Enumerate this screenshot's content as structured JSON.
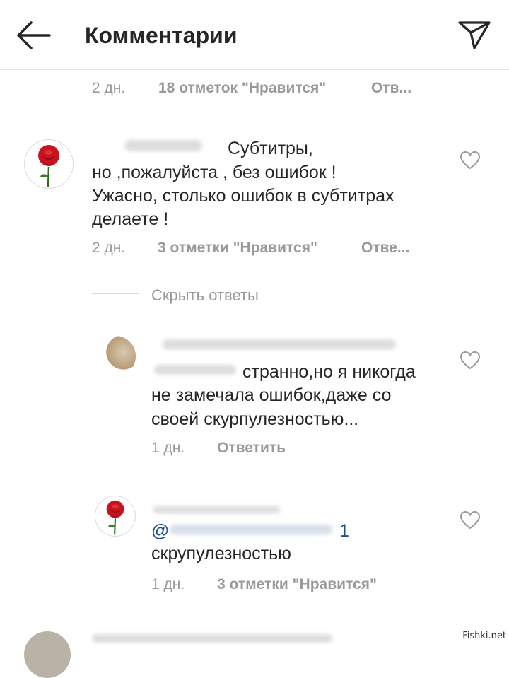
{
  "header": {
    "title": "Комментарии"
  },
  "top_comment_meta": {
    "time": "2 дн.",
    "likes": "18 отметок \"Нравится\"",
    "reply": "Отв..."
  },
  "comment_main": {
    "text_line1": "Субтитры,",
    "text_line2": "но ,пожалуйста , без ошибок !",
    "text_line3": "Ужасно, столько ошибок в субтитрах",
    "text_line4": "делаете !",
    "time": "2 дн.",
    "likes": "3 отметки \"Нравится\"",
    "reply": "Отве..."
  },
  "hide_replies": "Скрыть ответы",
  "reply1": {
    "text_line1": "странно,но я никогда",
    "text_line2": "не замечала ошибок,даже со",
    "text_line3": "своей скурпулезностью...",
    "time": "1 дн.",
    "reply": "Ответить"
  },
  "reply2": {
    "mention_start": "@",
    "mention_end": "1",
    "text_line1": "скрупулезностью",
    "time": "1 дн.",
    "likes": "3 отметки \"Нравится\""
  },
  "watermark": "Fishki.net",
  "colors": {
    "text": "#262626",
    "meta": "#999999",
    "mention": "#1f4d8c",
    "rose": "#c8141e"
  },
  "icons": [
    "back-arrow-icon",
    "send-icon",
    "heart-icon",
    "rose-avatar"
  ]
}
